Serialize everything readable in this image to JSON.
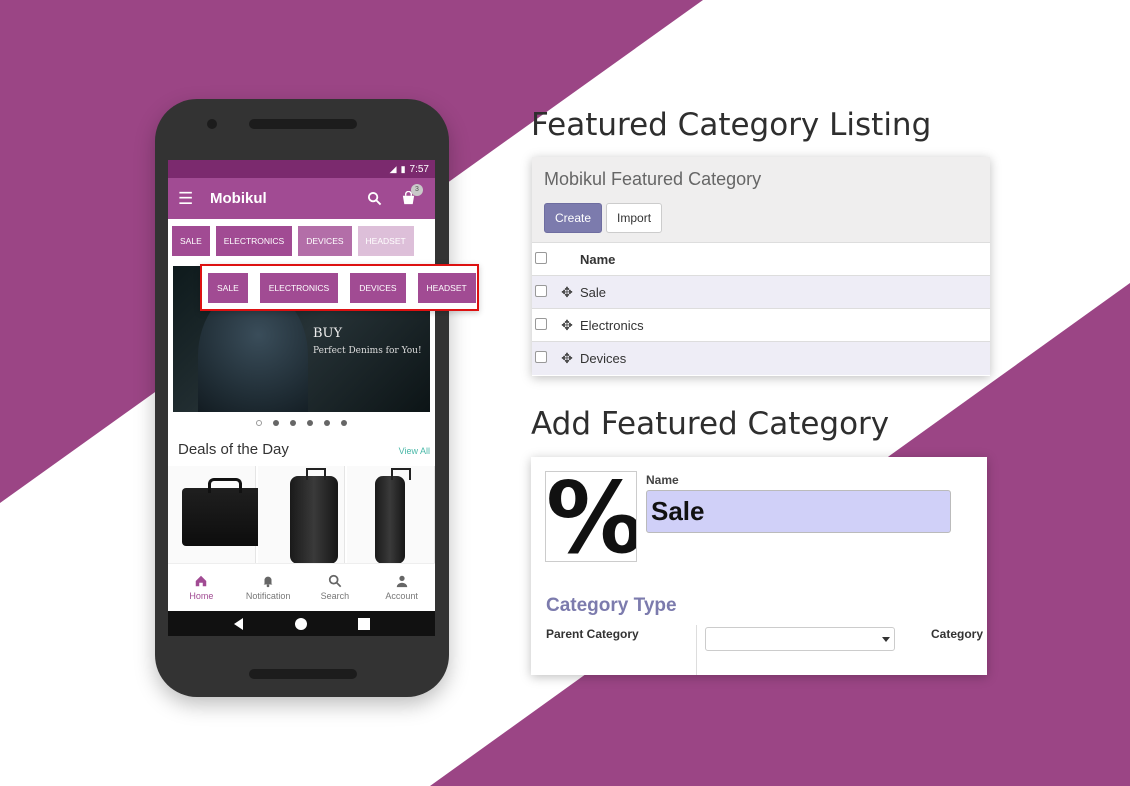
{
  "colors": {
    "brand": "#9b4585",
    "accent": "#7c7bad",
    "highlight": "#dd1111"
  },
  "phone": {
    "status_time": "7:57",
    "appbar": {
      "title": "Mobikul",
      "cart_count": "3"
    },
    "chips": [
      "SALE",
      "ELECTRONICS",
      "DEVICES",
      "HEADSET"
    ],
    "highlight_chips": [
      "SALE",
      "ELECTRONICS",
      "DEVICES",
      "HEADSET"
    ],
    "banner": {
      "headline": "BUY",
      "tagline": "Perfect Denims for You!"
    },
    "carousel": {
      "slides": 6,
      "active_index": 0
    },
    "deals": {
      "title": "Deals of the Day",
      "view_all": "View All"
    },
    "nav": {
      "home": "Home",
      "notification": "Notification",
      "search": "Search",
      "account": "Account"
    }
  },
  "listing": {
    "heading": "Featured Category Listing",
    "panel_title": "Mobikul Featured Category",
    "create_label": "Create",
    "import_label": "Import",
    "column_name": "Name",
    "rows": [
      "Sale",
      "Electronics",
      "Devices"
    ]
  },
  "form": {
    "heading": "Add Featured Category",
    "image_icon": "percent-icon",
    "name_label": "Name",
    "name_value": "Sale",
    "section_title": "Category Type",
    "parent_label": "Parent Category",
    "parent_value": "",
    "category_label": "Category"
  }
}
